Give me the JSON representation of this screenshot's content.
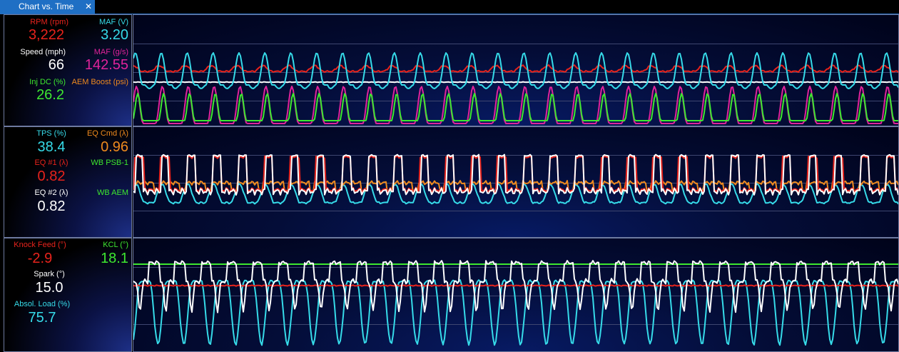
{
  "tab": {
    "title": "Chart vs. Time",
    "close": "✕"
  },
  "colors": {
    "red": "#e8231c",
    "cyan": "#36dbe9",
    "white": "#ffffff",
    "green": "#3ee830",
    "magenta": "#e0239a",
    "orange": "#ef8a1e"
  },
  "panels": [
    {
      "readouts": [
        {
          "label": "RPM (rpm)",
          "value": "3,222",
          "color": "#e8231c"
        },
        {
          "label": "MAF (V)",
          "value": "3.20",
          "color": "#36dbe9"
        },
        {
          "label": "Speed (mph)",
          "value": "66",
          "color": "#ffffff"
        },
        {
          "label": "MAF (g/s)",
          "value": "142.55",
          "color": "#e0239a"
        },
        {
          "label": "Inj DC (%)",
          "value": "26.2",
          "color": "#3ee830"
        },
        {
          "label": "AEM Boost (psi)",
          "value": "",
          "color": "#ef8a1e"
        }
      ]
    },
    {
      "readouts": [
        {
          "label": "TPS (%)",
          "value": "38.4",
          "color": "#36dbe9"
        },
        {
          "label": "EQ Cmd (λ)",
          "value": "0.96",
          "color": "#ef8a1e"
        },
        {
          "label": "EQ #1 (λ)",
          "value": "0.82",
          "color": "#e8231c"
        },
        {
          "label": "WB PSB-1",
          "value": "",
          "color": "#3ee830"
        },
        {
          "label": "EQ #2 (λ)",
          "value": "0.82",
          "color": "#ffffff"
        },
        {
          "label": "WB AEM",
          "value": "",
          "color": "#3ee830"
        }
      ]
    },
    {
      "readouts": [
        {
          "label": "Knock Feed (°)",
          "value": "-2.9",
          "color": "#e8231c"
        },
        {
          "label": "KCL (°)",
          "value": "18.1",
          "color": "#3ee830"
        },
        {
          "label": "Spark (°)",
          "value": "15.0",
          "color": "#ffffff"
        },
        {
          "label": "Absol. Load (%)",
          "value": "75.7",
          "color": "#36dbe9"
        }
      ]
    }
  ]
}
